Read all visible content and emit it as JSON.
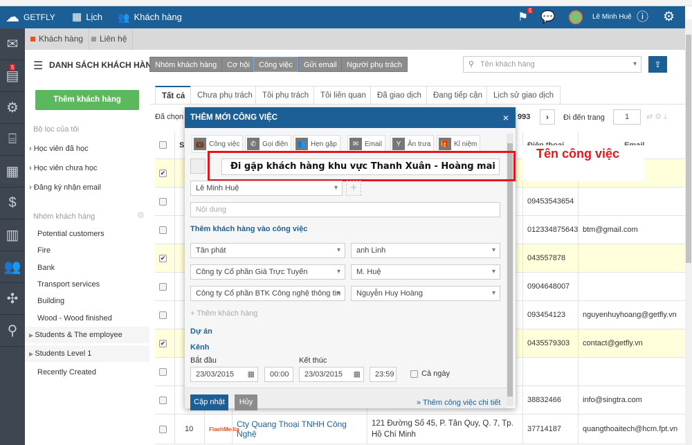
{
  "topbar": {
    "brand": "GETFLY",
    "calendar": "Lịch",
    "customers": "Khách hàng",
    "flag_badge": "5",
    "user": "Lê Minh Huệ"
  },
  "leftnav": {
    "mail_badge": "5"
  },
  "subtabs": [
    {
      "label": "Khách hàng",
      "color": "#e8501e"
    },
    {
      "label": "Liên hệ",
      "color": "#999999"
    }
  ],
  "header": {
    "title": "DANH SÁCH KHÁCH HÀNG",
    "buttons": [
      "Nhóm khách hàng",
      "Cơ hội",
      "Công việc",
      "Gửi email",
      "Người phụ trách"
    ],
    "search_placeholder": "Tên khách hàng"
  },
  "sidebar": {
    "add_button": "Thêm khách hàng",
    "filters_title": "Bộ lọc của tôi",
    "filters": [
      "Học viên đã học",
      "Học viên chưa học",
      "Đăng ký nhận email"
    ],
    "groups_title": "Nhóm khách hàng",
    "groups": [
      "Potential customers",
      "Fire",
      "Bank",
      "Transport services",
      "Building",
      "Wood - Wood finished",
      "Students & The employee",
      "Students Level 1",
      "Recently Created"
    ]
  },
  "tabs": [
    "Tất cả",
    "Chưa phụ trách",
    "Tôi phụ trách",
    "Tôi liên quan",
    "Đã giao dịch",
    "Đang tiếp cận",
    "Lịch sử giao dịch"
  ],
  "toolbar": {
    "selected": "Đã chọn",
    "count": "993",
    "goto": "Đi đến trang",
    "page": "1"
  },
  "table": {
    "headers": {
      "stt": "S",
      "phone": "Điện thoại",
      "email": "Email"
    },
    "rows": [
      {
        "checked": true,
        "phone": "",
        "email": ""
      },
      {
        "checked": false,
        "phone": "09453543654",
        "email": ""
      },
      {
        "checked": false,
        "phone": "012334875643",
        "email": "btm@gmail.com"
      },
      {
        "checked": true,
        "phone": "043557878",
        "email": ""
      },
      {
        "checked": false,
        "phone": "0904648007",
        "email": ""
      },
      {
        "checked": false,
        "phone": "093454123",
        "email": "nguyenhuyhoang@getfly.vn"
      },
      {
        "checked": true,
        "phone": "0435579303",
        "email": "contact@getfly.vn"
      },
      {
        "checked": false,
        "phone": "",
        "email": ""
      },
      {
        "checked": false,
        "phone": "38832466",
        "email": "info@singtra.com"
      },
      {
        "checked": false,
        "stt": "10",
        "logo": "FlashMedia",
        "name": "Cty Quang Thoại TNHH Công Nghệ",
        "address": "121 Đường Số 45, P. Tân Quy, Q. 7, Tp. Hồ Chí Minh",
        "phone": "37714187",
        "email": "quangthoaitech@hcm.fpt.vn"
      }
    ]
  },
  "dialog": {
    "title": "THÊM MỚI CÔNG VIỆC",
    "types": [
      "Công việc",
      "Gọi điện",
      "Hẹn gặp",
      "Email",
      "Ăn trưa",
      "Kỉ niệm"
    ],
    "task_name": "Đi gặp khách hàng khu vực Thanh Xuân - Hoàng mai",
    "task_placeholder": "Tên công việc",
    "assignee": "Lê Minh Huệ",
    "content_placeholder": "Nội dung",
    "add_customer_title": "Thêm khách hàng vào công việc",
    "customers": [
      {
        "company": "Tân phát",
        "contact": "anh Linh"
      },
      {
        "company": "Công ty Cổ phần Giá Trực Tuyến",
        "contact": "M. Huệ"
      },
      {
        "company": "Công ty Cổ phần BTK Công nghệ thông tin",
        "contact": "Nguyễn Huy Hoàng"
      }
    ],
    "add_customer": "Thêm khách hàng",
    "project": "Dự án",
    "channel": "Kênh",
    "start_label": "Bắt đầu",
    "end_label": "Kết thúc",
    "start_date": "23/03/2015",
    "start_time": "00:00",
    "end_date": "23/03/2015",
    "end_time": "23:59",
    "all_day": "Cả ngày",
    "submit": "Cập nhật",
    "cancel": "Hủy",
    "detail_link": "» Thêm công việc chi tiết"
  },
  "annotation": {
    "text": "Tên công việc",
    "color": "#e8141c"
  }
}
